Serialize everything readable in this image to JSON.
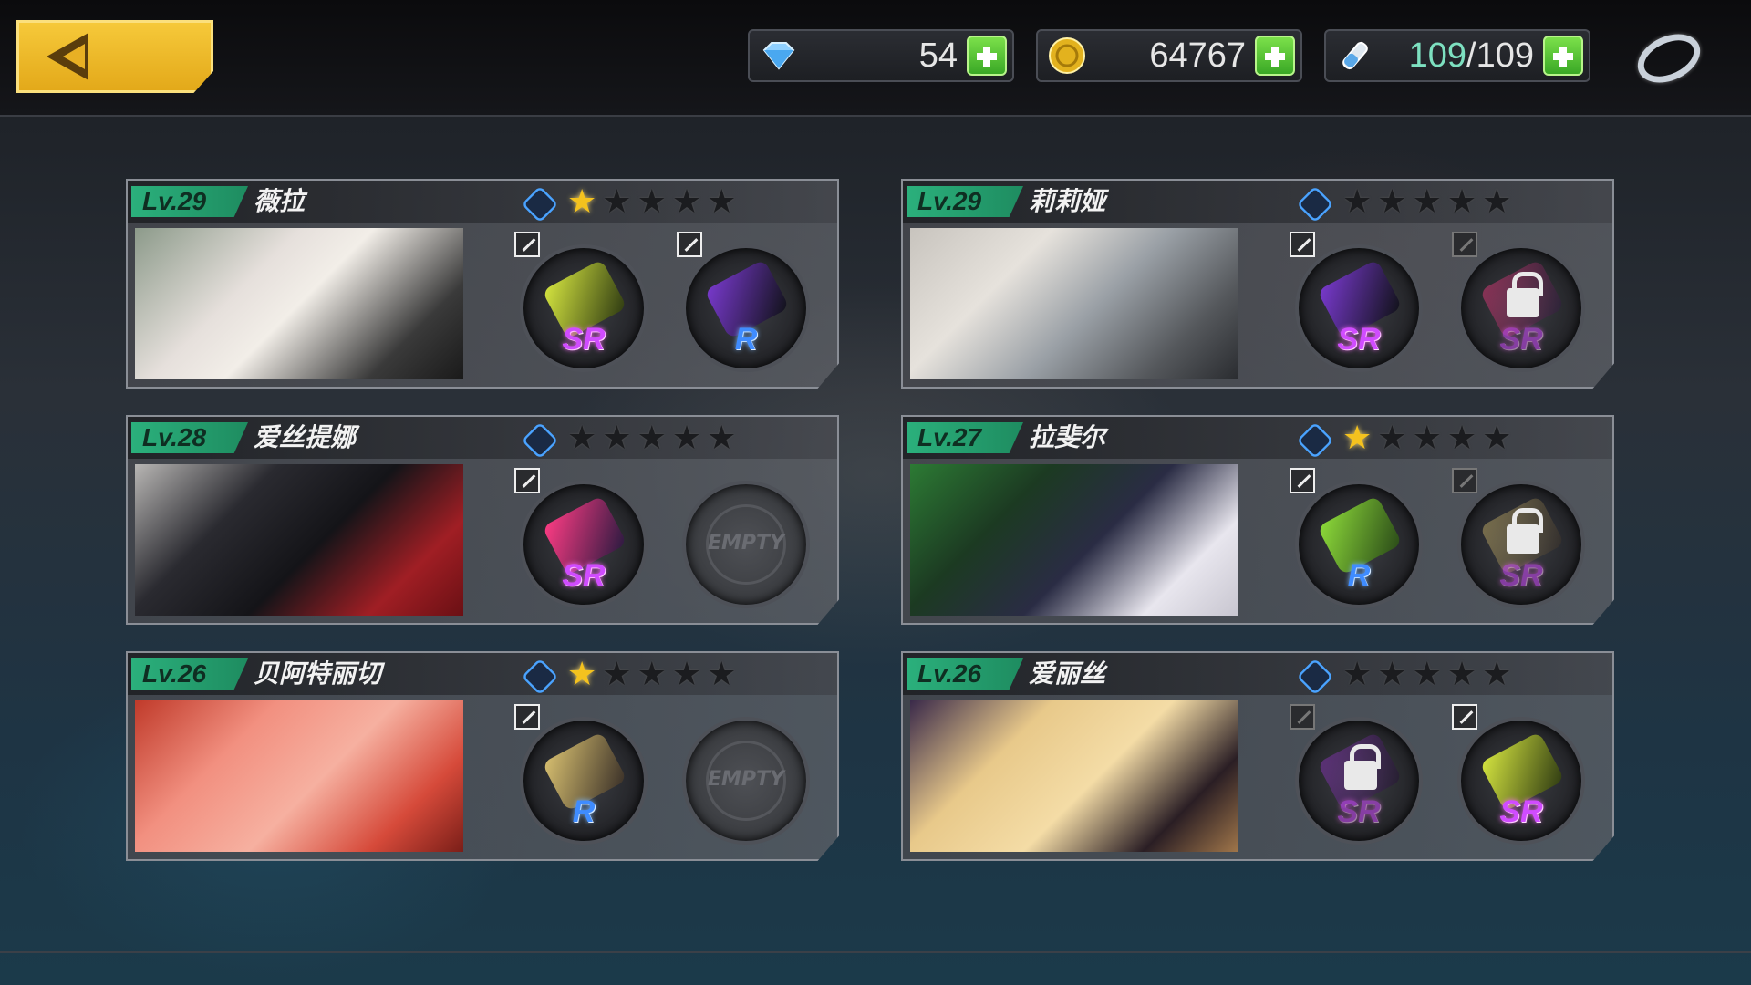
{
  "currencies": {
    "gems": "54",
    "gold": "64767",
    "stamina_current": "109",
    "stamina_sep": "/",
    "stamina_max": "109"
  },
  "icons": {
    "back": "chevron-left-icon",
    "gems": "gem-icon",
    "gold": "gold-coin-icon",
    "stamina": "stamina-potion-icon",
    "plus": "plus-icon",
    "ring": "ring-icon"
  },
  "colors": {
    "back_button": "#f0b928",
    "level_badge": "#2bb07c",
    "star_on": "#f4c21e",
    "grade_sr": "#d04cff",
    "grade_r": "#3f8cff",
    "plus_button": "#5bc63a"
  },
  "characters": [
    {
      "level": "Lv.29",
      "name": "薇拉",
      "stars_total": 5,
      "stars_filled": 1,
      "slots": [
        {
          "grade": "SR",
          "locked": false,
          "empty": false
        },
        {
          "grade": "R",
          "locked": false,
          "empty": false
        }
      ]
    },
    {
      "level": "Lv.29",
      "name": "莉莉娅",
      "stars_total": 5,
      "stars_filled": 0,
      "slots": [
        {
          "grade": "SR",
          "locked": false,
          "empty": false
        },
        {
          "grade": "SR",
          "locked": true,
          "empty": false
        }
      ]
    },
    {
      "level": "Lv.28",
      "name": "爱丝提娜",
      "stars_total": 5,
      "stars_filled": 0,
      "slots": [
        {
          "grade": "SR",
          "locked": false,
          "empty": false
        },
        {
          "label": "EMPTY",
          "locked": false,
          "empty": true
        }
      ]
    },
    {
      "level": "Lv.27",
      "name": "拉斐尔",
      "stars_total": 5,
      "stars_filled": 1,
      "slots": [
        {
          "grade": "R",
          "locked": false,
          "empty": false
        },
        {
          "grade": "SR",
          "locked": true,
          "empty": false
        }
      ]
    },
    {
      "level": "Lv.26",
      "name": "贝阿特丽切",
      "stars_total": 5,
      "stars_filled": 1,
      "slots": [
        {
          "grade": "R",
          "locked": false,
          "empty": false
        },
        {
          "label": "EMPTY",
          "locked": false,
          "empty": true
        }
      ]
    },
    {
      "level": "Lv.26",
      "name": "爱丽丝",
      "stars_total": 5,
      "stars_filled": 0,
      "slots": [
        {
          "grade": "SR",
          "locked": true,
          "empty": false
        },
        {
          "grade": "SR",
          "locked": false,
          "empty": false
        }
      ]
    }
  ]
}
